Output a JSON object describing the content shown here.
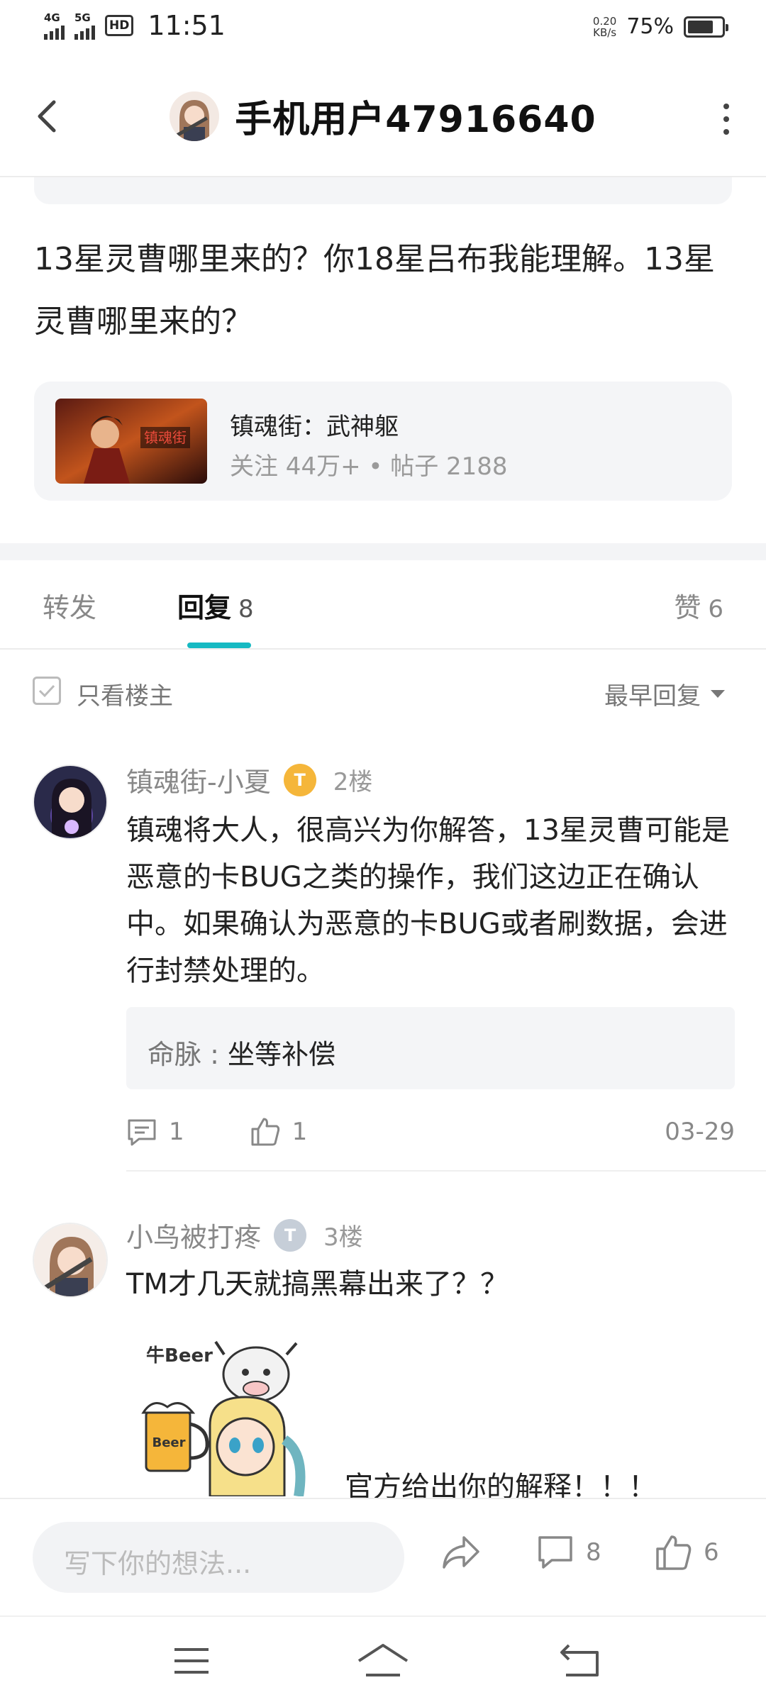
{
  "status_bar": {
    "signal1": "4G",
    "signal2": "5G",
    "hd": "HD",
    "time": "11:51",
    "net_speed_value": "0.20",
    "net_speed_unit": "KB/s",
    "battery_pct": "75%",
    "battery_level": 0.75
  },
  "header": {
    "title": "手机用户47916640"
  },
  "post": {
    "text": "13星灵曹哪里来的？你18星吕布我能理解。13星灵曹哪里来的？",
    "forum": {
      "name": "镇魂街：武神躯",
      "stats": "关注 44万+ • 帖子 2188"
    }
  },
  "tabs": {
    "forward": "转发",
    "reply": "回复",
    "reply_count": "8",
    "like": "赞",
    "like_count": "6"
  },
  "filter": {
    "only_op": "只看楼主",
    "sort": "最早回复"
  },
  "replies": [
    {
      "name": "镇魂街-小夏",
      "badge": "T",
      "floor": "2楼",
      "body": "镇魂将大人，很高兴为你解答，13星灵曹可能是恶意的卡BUG之类的操作，我们这边正在确认中。如果确认为恶意的卡BUG或者刷数据，会进行封禁处理的。",
      "quote_key": "命脉",
      "quote_value": "坐等补偿",
      "comments": "1",
      "likes": "1",
      "date": "03-29"
    },
    {
      "name": "小鸟被打疼",
      "badge": "T",
      "floor": "3楼",
      "body": "TM才几天就搞黑幕出来了？？",
      "sticker_caption": "官方给出你的解释！！！"
    }
  ],
  "bottom_bar": {
    "placeholder": "写下你的想法...",
    "comment_count": "8",
    "like_count": "6"
  },
  "colors": {
    "accent": "#16b9c2",
    "gold_badge": "#f5b63a",
    "silver_badge": "#c6ced8"
  }
}
